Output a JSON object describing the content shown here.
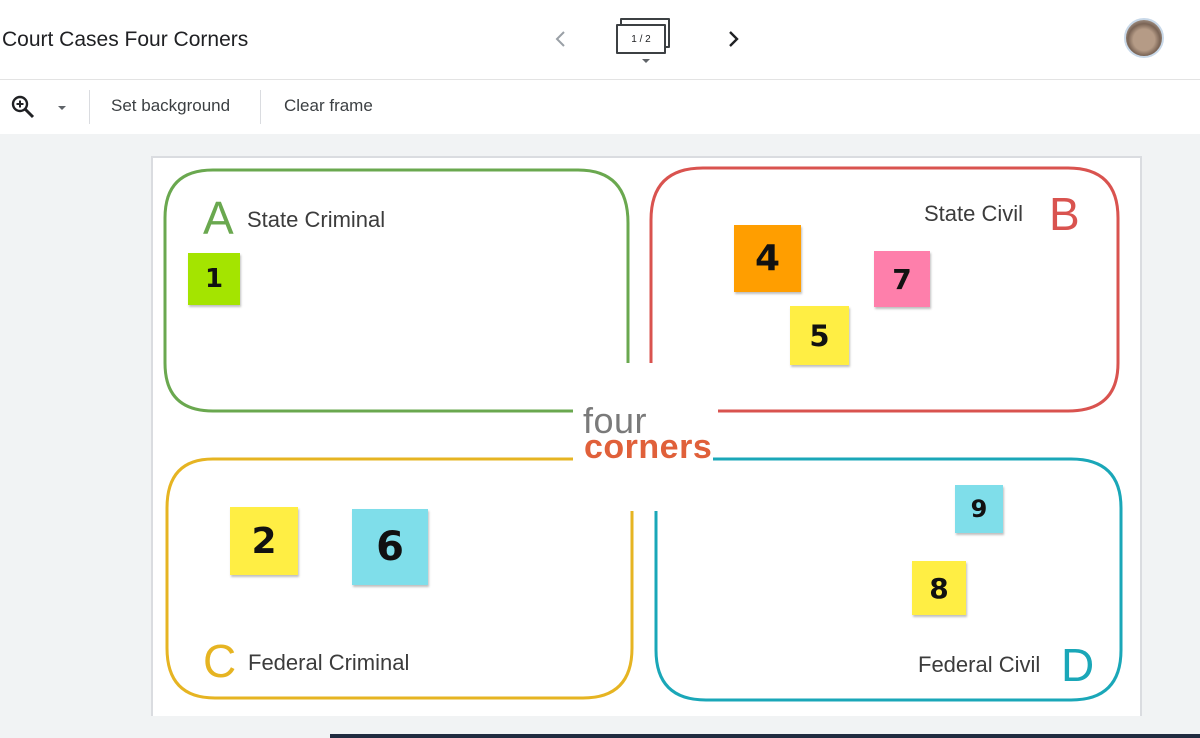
{
  "header": {
    "title": "Court Cases Four Corners",
    "frame_indicator": "1 / 2"
  },
  "icons": {
    "prev": "chevron-left-icon",
    "next": "chevron-right-icon",
    "zoom": "zoom-in-icon",
    "zoom_dropdown": "caret-down-icon",
    "avatar": "user-avatar"
  },
  "toolbar": {
    "set_background": "Set background",
    "clear_frame": "Clear frame"
  },
  "board": {
    "logo_top": "four",
    "logo_bottom": "corners",
    "corners": [
      {
        "letter": "A",
        "label": "State Criminal",
        "color": "#6aa84f"
      },
      {
        "letter": "B",
        "label": "State Civil",
        "color": "#d9534f"
      },
      {
        "letter": "C",
        "label": "Federal Criminal",
        "color": "#e6b422"
      },
      {
        "letter": "D",
        "label": "Federal Civil",
        "color": "#1aa7b8"
      }
    ],
    "stickies": [
      {
        "label": "1",
        "color": "#a4e400"
      },
      {
        "label": "4",
        "color": "#ff9e00"
      },
      {
        "label": "7",
        "color": "#fe7fab"
      },
      {
        "label": "5",
        "color": "#ffee44"
      },
      {
        "label": "2",
        "color": "#ffee44"
      },
      {
        "label": "6",
        "color": "#7fdeea"
      },
      {
        "label": "9",
        "color": "#7fdeea"
      },
      {
        "label": "8",
        "color": "#ffee44"
      }
    ]
  }
}
